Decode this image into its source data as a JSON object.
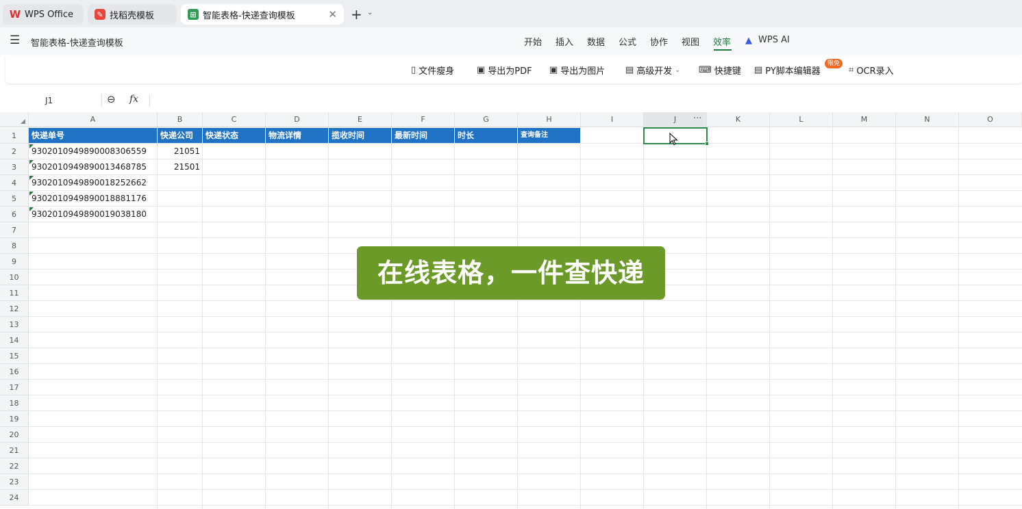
{
  "tabs": [
    {
      "label": "WPS Office",
      "icon": "wps-logo-icon"
    },
    {
      "label": "找稻壳模板",
      "icon": "docer-icon"
    },
    {
      "label": "智能表格-快递查询模板",
      "icon": "smart-sheet-icon",
      "active": true
    }
  ],
  "tab_actions": {
    "new_tab": "+",
    "dropdown": "⌄",
    "close": "✕"
  },
  "menubar": {
    "doc_title": "智能表格-快递查询模板",
    "items": [
      "开始",
      "插入",
      "数据",
      "公式",
      "协作",
      "视图",
      "效率",
      "WPS AI"
    ],
    "active_item": "效率",
    "accent_color": "#1d7a3b"
  },
  "toolbar": {
    "items": [
      "文件瘦身",
      "导出为PDF",
      "导出为图片",
      "高级开发",
      "快捷键",
      "PY脚本编辑器",
      "OCR录入"
    ],
    "promo_badge": "限免"
  },
  "formula_bar": {
    "name_box": "J1",
    "fx_label": "fx",
    "formula": ""
  },
  "grid": {
    "columns": [
      "A",
      "B",
      "C",
      "D",
      "E",
      "F",
      "G",
      "H",
      "I",
      "J",
      "K",
      "L",
      "M",
      "N",
      "O"
    ],
    "rows": [
      "1",
      "2",
      "3",
      "4",
      "5",
      "6",
      "7",
      "8",
      "9",
      "10",
      "11",
      "12",
      "13",
      "14",
      "15",
      "16",
      "17",
      "18",
      "19",
      "20",
      "21",
      "22",
      "23",
      "24"
    ],
    "selected_cell": "J1",
    "header_row": [
      "快递单号",
      "快递公司",
      "快递状态",
      "物流详情",
      "揽收时间",
      "最新时间",
      "时长",
      "查询备注"
    ],
    "header_color": "#1f72c4",
    "data_rows": [
      [
        "930201094989000830655​9",
        "21051"
      ],
      [
        "9302010949890013468785",
        "21501"
      ],
      [
        "9302010949890018252662",
        ""
      ],
      [
        "9302010949890018881176",
        ""
      ],
      [
        "9302010949890019038180",
        ""
      ]
    ]
  },
  "overlay": {
    "text": "在线表格，一件查快递",
    "bg_color": "#6b9a28"
  }
}
